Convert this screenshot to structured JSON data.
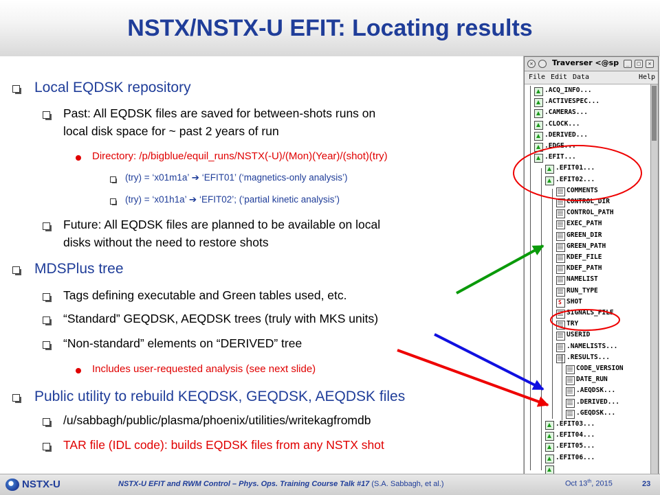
{
  "slide": {
    "title": "NSTX/NSTX-U EFIT: Locating results",
    "bullets": [
      {
        "level": 1,
        "text": "Local EQDSK repository"
      },
      {
        "level": 2,
        "text": "Past: All EQDSK files are saved for between-shots runs on"
      },
      {
        "level": 2,
        "cont": true,
        "text": "local disk space for ~ past 2 years of run"
      },
      {
        "level": 3,
        "text": "Directory: /p/bigblue/equil_runs/NSTX(-U)/(Mon)(Year)/(shot)(try)"
      },
      {
        "level": 4,
        "text": "(try) = ‘x01m1a’ ➔ ‘EFIT01’ (‘magnetics-only analysis’)"
      },
      {
        "level": 4,
        "text": "(try) = ‘x01h1a’ ➔ ‘EFIT02’; (‘partial kinetic analysis’)"
      },
      {
        "level": 2,
        "text": "Future: All EQDSK files are planned to be available on local"
      },
      {
        "level": 2,
        "cont": true,
        "text": "disks without the need to restore shots"
      },
      {
        "level": 1,
        "text": "MDSPlus tree"
      },
      {
        "level": 2,
        "text": "Tags defining executable and Green tables used, etc."
      },
      {
        "level": 2,
        "text": "“Standard” GEQDSK, AEQDSK trees (truly with MKS units)"
      },
      {
        "level": 2,
        "text": "“Non-standard” elements on “DERIVED” tree"
      },
      {
        "level": 3,
        "text": "Includes user-requested analysis (see next slide)"
      },
      {
        "level": 1,
        "text": "Public utility to rebuild KEQDSK, GEQDSK, AEQDSK files"
      },
      {
        "level": 2,
        "text": "/u/sabbagh/public/plasma/phoenix/utilities/writekagfromdb"
      },
      {
        "level": 2,
        "red": true,
        "text": "TAR file (IDL code): builds EQDSK files from any NSTX shot"
      }
    ]
  },
  "traverser": {
    "window_title": "Traverser <@sp",
    "menu": [
      "File",
      "Edit",
      "Data",
      "Help"
    ],
    "nodes": [
      {
        "label": ".ACQ_INFO...",
        "depth": 0,
        "icon": "struct"
      },
      {
        "label": ".ACTIVESPEC...",
        "depth": 0,
        "icon": "struct"
      },
      {
        "label": ".CAMERAS...",
        "depth": 0,
        "icon": "struct"
      },
      {
        "label": ".CLOCK...",
        "depth": 0,
        "icon": "struct"
      },
      {
        "label": ".DERIVED...",
        "depth": 0,
        "icon": "struct"
      },
      {
        "label": ".EDGE...",
        "depth": 0,
        "icon": "struct"
      },
      {
        "label": ".EFIT...",
        "depth": 0,
        "icon": "struct"
      },
      {
        "label": ".EFIT01...",
        "depth": 1,
        "icon": "struct"
      },
      {
        "label": ".EFIT02...",
        "depth": 1,
        "icon": "struct"
      },
      {
        "label": "COMMENTS",
        "depth": 2,
        "icon": "leaf"
      },
      {
        "label": "CONTROL_DIR",
        "depth": 2,
        "icon": "leaf"
      },
      {
        "label": "CONTROL_PATH",
        "depth": 2,
        "icon": "leaf"
      },
      {
        "label": "EXEC_PATH",
        "depth": 2,
        "icon": "leaf"
      },
      {
        "label": "GREEN_DIR",
        "depth": 2,
        "icon": "leaf"
      },
      {
        "label": "GREEN_PATH",
        "depth": 2,
        "icon": "leaf"
      },
      {
        "label": "KDEF_FILE",
        "depth": 2,
        "icon": "leaf"
      },
      {
        "label": "KDEF_PATH",
        "depth": 2,
        "icon": "leaf"
      },
      {
        "label": "NAMELIST",
        "depth": 2,
        "icon": "leaf"
      },
      {
        "label": "RUN_TYPE",
        "depth": 2,
        "icon": "leaf"
      },
      {
        "label": "SHOT",
        "depth": 2,
        "icon": "sig"
      },
      {
        "label": "SIGNALS_FILE",
        "depth": 2,
        "icon": "leaf"
      },
      {
        "label": "TRY",
        "depth": 2,
        "icon": "leaf"
      },
      {
        "label": "USERID",
        "depth": 2,
        "icon": "leaf"
      },
      {
        "label": ".NAMELISTS...",
        "depth": 2,
        "icon": "leaf"
      },
      {
        "label": ".RESULTS...",
        "depth": 2,
        "icon": "leaf"
      },
      {
        "label": "CODE_VERSION",
        "depth": 3,
        "icon": "leaf"
      },
      {
        "label": "DATE_RUN",
        "depth": 3,
        "icon": "leaf"
      },
      {
        "label": ".AEQDSK...",
        "depth": 3,
        "icon": "leaf"
      },
      {
        "label": ".DERIVED...",
        "depth": 3,
        "icon": "leaf"
      },
      {
        "label": ".GEQDSK...",
        "depth": 3,
        "icon": "leaf"
      },
      {
        "label": ".EFIT03...",
        "depth": 1,
        "icon": "struct"
      },
      {
        "label": ".EFIT04...",
        "depth": 1,
        "icon": "struct"
      },
      {
        "label": ".EFIT05...",
        "depth": 1,
        "icon": "struct"
      },
      {
        "label": ".EFIT06...",
        "depth": 1,
        "icon": "struct"
      },
      {
        "label": "",
        "depth": 1,
        "icon": "struct"
      }
    ]
  },
  "footer": {
    "logo_text": "NSTX-U",
    "course": "NSTX-U EFIT and RWM Control – Phys. Ops. Training Course Talk #17",
    "authors": "(S.A. Sabbagh, et al.)",
    "date_prefix": "Oct 13",
    "date_sup": "th",
    "date_suffix": ", 2015",
    "page": "23"
  },
  "colors": {
    "title": "#1f3d99",
    "red": "#e00000",
    "green_arrow": "#0a9a0a",
    "blue_arrow": "#1010e0",
    "red_arrow": "#ee0000"
  }
}
